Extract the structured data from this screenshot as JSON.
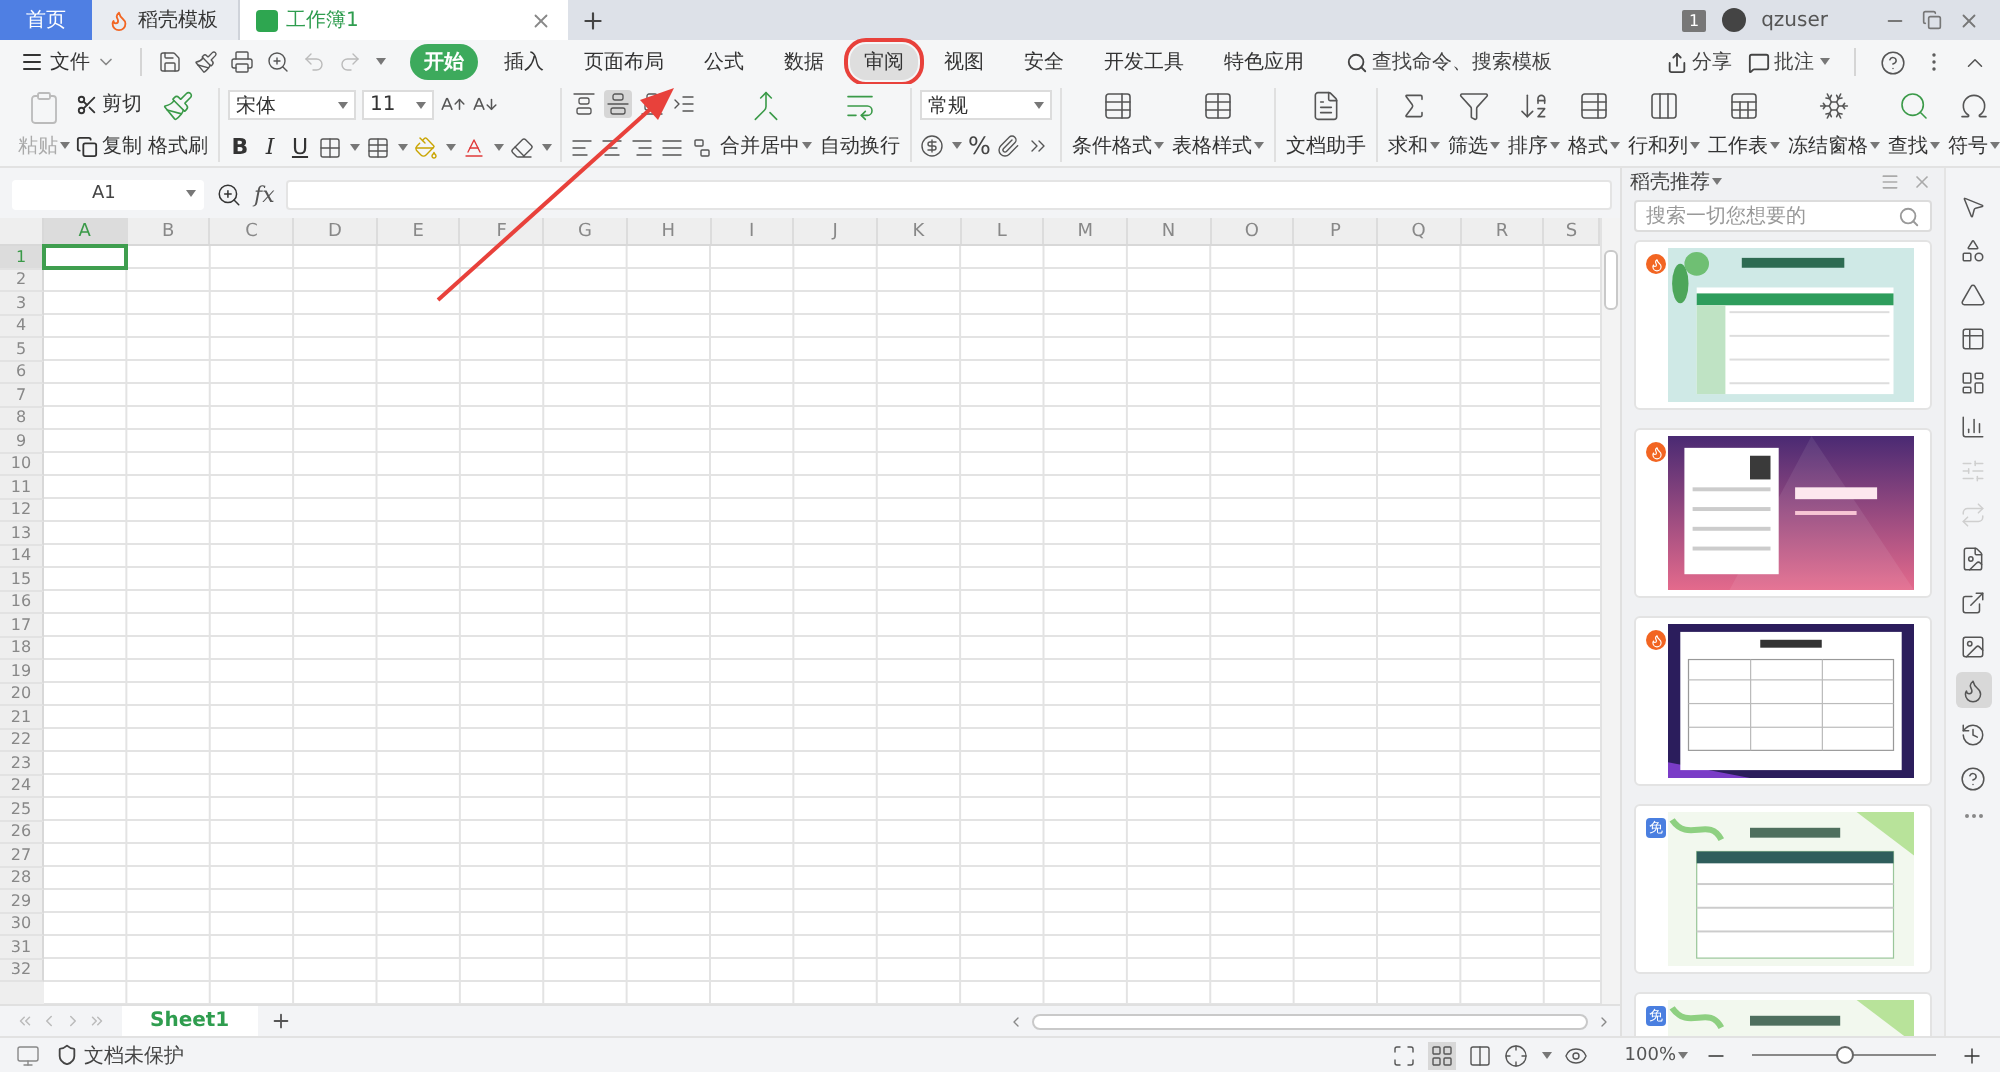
{
  "tabs": [
    {
      "label": "首页",
      "kind": "home",
      "selected": false
    },
    {
      "label": "稻壳模板",
      "kind": "docer",
      "selected": false
    },
    {
      "label": "工作簿1",
      "kind": "sheet",
      "selected": true
    }
  ],
  "account": {
    "badge": "1",
    "user": "qzuser"
  },
  "menu": {
    "file": "文件",
    "tabs": [
      {
        "label": "开始",
        "selected": true,
        "annotated": false
      },
      {
        "label": "插入",
        "selected": false,
        "annotated": false
      },
      {
        "label": "页面布局",
        "selected": false,
        "annotated": false
      },
      {
        "label": "公式",
        "selected": false,
        "annotated": false
      },
      {
        "label": "数据",
        "selected": false,
        "annotated": false
      },
      {
        "label": "审阅",
        "selected": false,
        "annotated": true
      },
      {
        "label": "视图",
        "selected": false,
        "annotated": false
      },
      {
        "label": "安全",
        "selected": false,
        "annotated": false
      },
      {
        "label": "开发工具",
        "selected": false,
        "annotated": false
      },
      {
        "label": "特色应用",
        "selected": false,
        "annotated": false
      }
    ],
    "search": "查找命令、搜索模板",
    "share": "分享",
    "comment": "批注"
  },
  "ribbon": {
    "clipboard": {
      "paste": {
        "label": "粘贴",
        "disabled": true
      },
      "cut": "剪切",
      "copy": "复制",
      "painter": "格式刷"
    },
    "font": {
      "name": "宋体",
      "size": "11",
      "styles": [
        "B",
        "I",
        "U"
      ]
    },
    "alignment": [
      {
        "selected": false
      },
      {
        "selected": true
      },
      {
        "selected": false
      }
    ],
    "merge": [
      {
        "label": "合并居中",
        "dropdown": true
      },
      {
        "label": "自动换行",
        "dropdown": false
      }
    ],
    "number": {
      "format": "常规",
      "percent": "%"
    },
    "styles": [
      {
        "label": "条件格式",
        "dropdown": true
      },
      {
        "label": "表格样式",
        "dropdown": true
      },
      {
        "label": "文档助手",
        "dropdown": false
      }
    ],
    "tools": [
      {
        "label": "求和",
        "dropdown": true
      },
      {
        "label": "筛选",
        "dropdown": true
      },
      {
        "label": "排序",
        "dropdown": true
      },
      {
        "label": "格式",
        "dropdown": true
      },
      {
        "label": "行和列",
        "dropdown": true
      },
      {
        "label": "工作表",
        "dropdown": true
      },
      {
        "label": "冻结窗格",
        "dropdown": true
      },
      {
        "label": "查找",
        "dropdown": true
      },
      {
        "label": "符号",
        "dropdown": true
      }
    ]
  },
  "formula_bar": {
    "name_box": "A1",
    "fx": "fx"
  },
  "columns": [
    {
      "label": "A",
      "selected": true
    },
    {
      "label": "B",
      "selected": false
    },
    {
      "label": "C",
      "selected": false
    },
    {
      "label": "D",
      "selected": false
    },
    {
      "label": "E",
      "selected": false
    },
    {
      "label": "F",
      "selected": false
    },
    {
      "label": "G",
      "selected": false
    },
    {
      "label": "H",
      "selected": false
    },
    {
      "label": "I",
      "selected": false
    },
    {
      "label": "J",
      "selected": false
    },
    {
      "label": "K",
      "selected": false
    },
    {
      "label": "L",
      "selected": false
    },
    {
      "label": "M",
      "selected": false
    },
    {
      "label": "N",
      "selected": false
    },
    {
      "label": "O",
      "selected": false
    },
    {
      "label": "P",
      "selected": false
    },
    {
      "label": "Q",
      "selected": false
    },
    {
      "label": "R",
      "selected": false
    },
    {
      "label": "S",
      "selected": false
    }
  ],
  "rows": [
    {
      "label": "1",
      "selected": true
    },
    {
      "label": "2",
      "selected": false
    },
    {
      "label": "3",
      "selected": false
    },
    {
      "label": "4",
      "selected": false
    },
    {
      "label": "5",
      "selected": false
    },
    {
      "label": "6",
      "selected": false
    },
    {
      "label": "7",
      "selected": false
    },
    {
      "label": "8",
      "selected": false
    },
    {
      "label": "9",
      "selected": false
    },
    {
      "label": "10",
      "selected": false
    },
    {
      "label": "11",
      "selected": false
    },
    {
      "label": "12",
      "selected": false
    },
    {
      "label": "13",
      "selected": false
    },
    {
      "label": "14",
      "selected": false
    },
    {
      "label": "15",
      "selected": false
    },
    {
      "label": "16",
      "selected": false
    },
    {
      "label": "17",
      "selected": false
    },
    {
      "label": "18",
      "selected": false
    },
    {
      "label": "19",
      "selected": false
    },
    {
      "label": "20",
      "selected": false
    },
    {
      "label": "21",
      "selected": false
    },
    {
      "label": "22",
      "selected": false
    },
    {
      "label": "23",
      "selected": false
    },
    {
      "label": "24",
      "selected": false
    },
    {
      "label": "25",
      "selected": false
    },
    {
      "label": "26",
      "selected": false
    },
    {
      "label": "27",
      "selected": false
    },
    {
      "label": "28",
      "selected": false
    },
    {
      "label": "29",
      "selected": false
    },
    {
      "label": "30",
      "selected": false
    },
    {
      "label": "31",
      "selected": false
    },
    {
      "label": "32",
      "selected": false
    }
  ],
  "sheets": [
    {
      "label": "Sheet1",
      "selected": true
    }
  ],
  "panel": {
    "title": "稻壳推荐",
    "search_placeholder": "搜索一切您想要的",
    "cards": [
      {
        "kind": "hot"
      },
      {
        "kind": "hot"
      },
      {
        "kind": "hot"
      },
      {
        "kind": "free",
        "badge": "免"
      },
      {
        "kind": "free",
        "badge": "免"
      }
    ]
  },
  "rail": [
    {
      "selected": false,
      "disabled": false
    },
    {
      "selected": false,
      "disabled": false
    },
    {
      "selected": false,
      "disabled": false
    },
    {
      "selected": false,
      "disabled": false
    },
    {
      "selected": false,
      "disabled": false
    },
    {
      "selected": false,
      "disabled": false
    },
    {
      "selected": false,
      "disabled": true
    },
    {
      "selected": false,
      "disabled": true
    },
    {
      "selected": false,
      "disabled": false
    },
    {
      "selected": false,
      "disabled": false
    },
    {
      "selected": false,
      "disabled": false
    },
    {
      "selected": true,
      "disabled": false
    },
    {
      "selected": false,
      "disabled": false
    },
    {
      "selected": false,
      "disabled": false
    }
  ],
  "status": {
    "protect": "文档未保护",
    "zoom": "100%",
    "zoom_slider": {
      "level": 0.5
    }
  }
}
